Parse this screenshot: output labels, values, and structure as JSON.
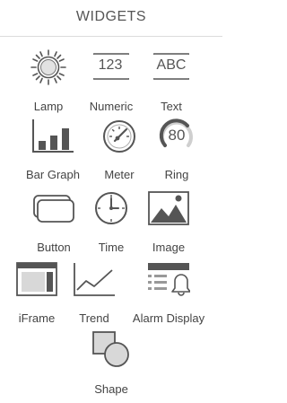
{
  "panel": {
    "title": "WIDGETS"
  },
  "widgets": [
    {
      "label": "Lamp",
      "icon": "lamp-icon"
    },
    {
      "label": "Numeric",
      "icon": "numeric-icon",
      "glyph": "123"
    },
    {
      "label": "Text",
      "icon": "text-icon",
      "glyph": "ABC"
    },
    {
      "label": "Bar Graph",
      "icon": "bar-graph-icon"
    },
    {
      "label": "Meter",
      "icon": "meter-icon"
    },
    {
      "label": "Ring",
      "icon": "ring-icon",
      "glyph": "80"
    },
    {
      "label": "Button",
      "icon": "button-icon"
    },
    {
      "label": "Time",
      "icon": "clock-icon"
    },
    {
      "label": "Image",
      "icon": "image-icon"
    },
    {
      "label": "iFrame",
      "icon": "iframe-icon"
    },
    {
      "label": "Trend",
      "icon": "trend-icon"
    },
    {
      "label": "Alarm Display",
      "icon": "alarm-display-icon"
    },
    {
      "label": "Shape",
      "icon": "shape-icon"
    }
  ]
}
